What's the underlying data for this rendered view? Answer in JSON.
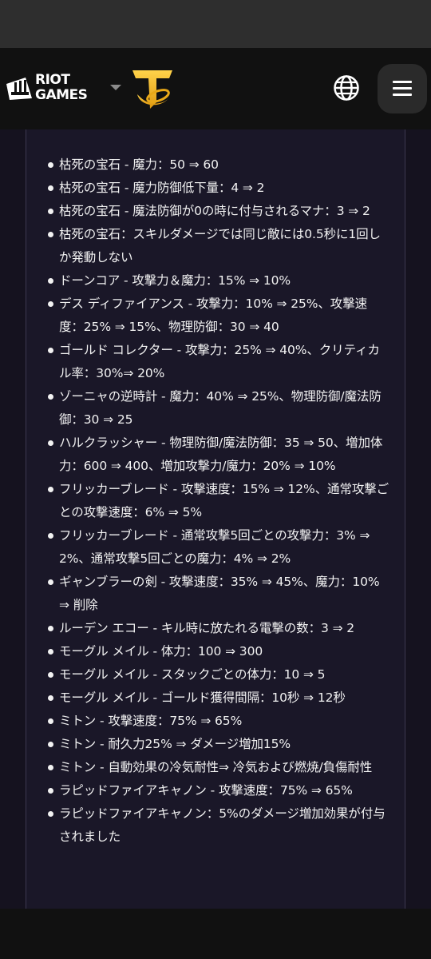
{
  "header": {
    "brand_text": "RIOT\nGAMES",
    "brand_icon": "riot-fist-icon",
    "game_icon": "tft-logo-icon",
    "language_icon": "globe-icon",
    "menu_icon": "hamburger-menu-icon"
  },
  "patch_notes": {
    "items": [
      "枯死の宝石 - 魔力：50 ⇒ 60",
      "枯死の宝石 - 魔力防御低下量：4 ⇒ 2",
      "枯死の宝石 - 魔法防御が0の時に付与されるマナ：3 ⇒ 2",
      "枯死の宝石：スキルダメージでは同じ敵には0.5秒に1回しか発動しない",
      "ドーンコア - 攻撃力＆魔力：15% ⇒ 10%",
      "デス ディファイアンス - 攻撃力：10% ⇒ 25%、攻撃速度：25% ⇒ 15%、物理防御：30 ⇒ 40",
      "ゴールド コレクター - 攻撃力：25% ⇒ 40%、クリティカル率：30%⇒ 20%",
      "ゾーニャの逆時計 - 魔力：40% ⇒ 25%、物理防御/魔法防御：30 ⇒ 25",
      "ハルクラッシャー - 物理防御/魔法防御：35 ⇒ 50、増加体力：600 ⇒ 400、増加攻撃力/魔力：20% ⇒ 10%",
      "フリッカーブレード - 攻撃速度：15% ⇒ 12%、通常攻撃ごとの攻撃速度：6% ⇒ 5%",
      "フリッカーブレード - 通常攻撃5回ごとの攻撃力：3% ⇒ 2%、通常攻撃5回ごとの魔力：4% ⇒ 2%",
      "ギャンブラーの剣 - 攻撃速度：35% ⇒ 45%、魔力：10% ⇒ 削除",
      "ルーデン エコー - キル時に放たれる電撃の数：3 ⇒ 2",
      "モーグル メイル - 体力：100 ⇒ 300",
      "モーグル メイル - スタックごとの体力：10 ⇒ 5",
      "モーグル メイル - ゴールド獲得間隔：10秒 ⇒ 12秒",
      "ミトン - 攻撃速度：75% ⇒ 65%",
      "ミトン - 耐久力25% ⇒ ダメージ増加15%",
      "ミトン - 自動効果の冷気耐性⇒ 冷気および燃焼/負傷耐性",
      "ラピッドファイアキャノン - 攻撃速度：75% ⇒ 65%",
      "ラピッドファイアキャノン：5%のダメージ増加効果が付与されました"
    ]
  }
}
